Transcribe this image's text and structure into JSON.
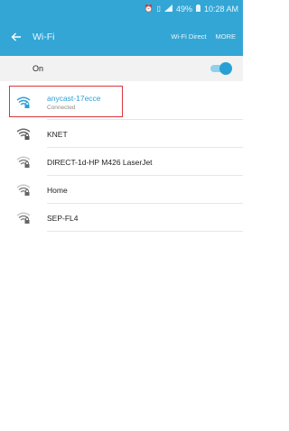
{
  "status_bar": {
    "alarm_icon": "alarm-icon",
    "vibrate_icon": "vibrate-icon",
    "signal_icon": "signal-icon",
    "battery": "49%",
    "battery_icon": "battery-icon",
    "time": "10:28 AM"
  },
  "app_bar": {
    "title": "Wi-Fi",
    "wifi_direct": "Wi-Fi Direct",
    "more": "MORE"
  },
  "toggle": {
    "label": "On",
    "state": "on"
  },
  "networks": [
    {
      "name": "anycast-17ecce",
      "status": "Connected",
      "signal": "full",
      "locked": true
    },
    {
      "name": "KNET",
      "status": "",
      "signal": "full",
      "locked": true
    },
    {
      "name": "DIRECT-1d-HP M426 LaserJet",
      "status": "",
      "signal": "medium",
      "locked": true
    },
    {
      "name": "Home",
      "status": "",
      "signal": "medium",
      "locked": true
    },
    {
      "name": "SEP-FL4",
      "status": "",
      "signal": "medium",
      "locked": true
    }
  ],
  "colors": {
    "accent": "#33a6d6",
    "connected": "#2d9fd6",
    "highlight_box": "#d9363e"
  }
}
